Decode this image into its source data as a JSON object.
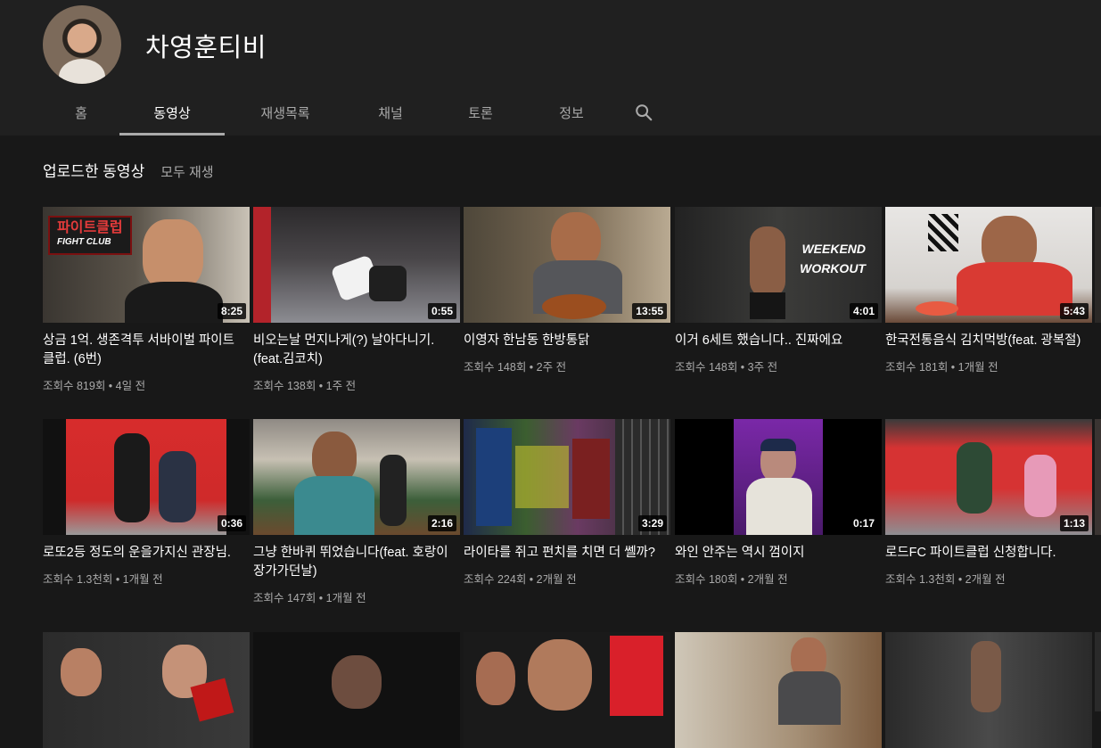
{
  "channel": {
    "name": "차영훈티비"
  },
  "tabs": [
    {
      "label": "홈"
    },
    {
      "label": "동영상"
    },
    {
      "label": "재생목록"
    },
    {
      "label": "채널"
    },
    {
      "label": "토론"
    },
    {
      "label": "정보"
    }
  ],
  "section": {
    "title": "업로드한 동영상",
    "play_all": "모두 재생"
  },
  "thumb_texts": {
    "fight_club_kr": "파이트클럽",
    "fight_club_en": "FIGHT CLUB",
    "weekend_1": "WEEKEND",
    "weekend_2": "WORKOUT"
  },
  "rows": [
    [
      {
        "title": "상금 1억. 생존격투 서바이벌 파이트클럽. (6번)",
        "duration": "8:25",
        "meta": "조회수 819회 • 4일 전"
      },
      {
        "title": "비오는날 먼지나게(?) 날아다니기. (feat.김코치)",
        "duration": "0:55",
        "meta": "조회수 138회 • 1주 전"
      },
      {
        "title": "이영자 한남동 한방통닭",
        "duration": "13:55",
        "meta": "조회수 148회 • 2주 전"
      },
      {
        "title": "이거 6세트 했습니다.. 진짜에요",
        "duration": "4:01",
        "meta": "조회수 148회 • 3주 전"
      },
      {
        "title": "한국전통음식 김치먹방(feat. 광복절)",
        "duration": "5:43",
        "meta": "조회수 181회 • 1개월 전"
      }
    ],
    [
      {
        "title": "로또2등 정도의 운을가지신 관장님.",
        "duration": "0:36",
        "meta": "조회수 1.3천회 • 1개월 전"
      },
      {
        "title": "그냥 한바퀴 뛰었습니다(feat. 호랑이장가가던날)",
        "duration": "2:16",
        "meta": "조회수 147회 • 1개월 전"
      },
      {
        "title": "라이타를 쥐고 펀치를 치면 더 쎌까?",
        "duration": "3:29",
        "meta": "조회수 224회 • 2개월 전"
      },
      {
        "title": "와인 안주는 역시 껌이지",
        "duration": "0:17",
        "meta": "조회수 180회 • 2개월 전"
      },
      {
        "title": "로드FC 파이트클럽 신청합니다.",
        "duration": "1:13",
        "meta": "조회수 1.3천회 • 2개월 전"
      }
    ]
  ],
  "colors": {
    "background": "#181818",
    "header": "#202020",
    "secondary_text": "#aaaaaa"
  }
}
